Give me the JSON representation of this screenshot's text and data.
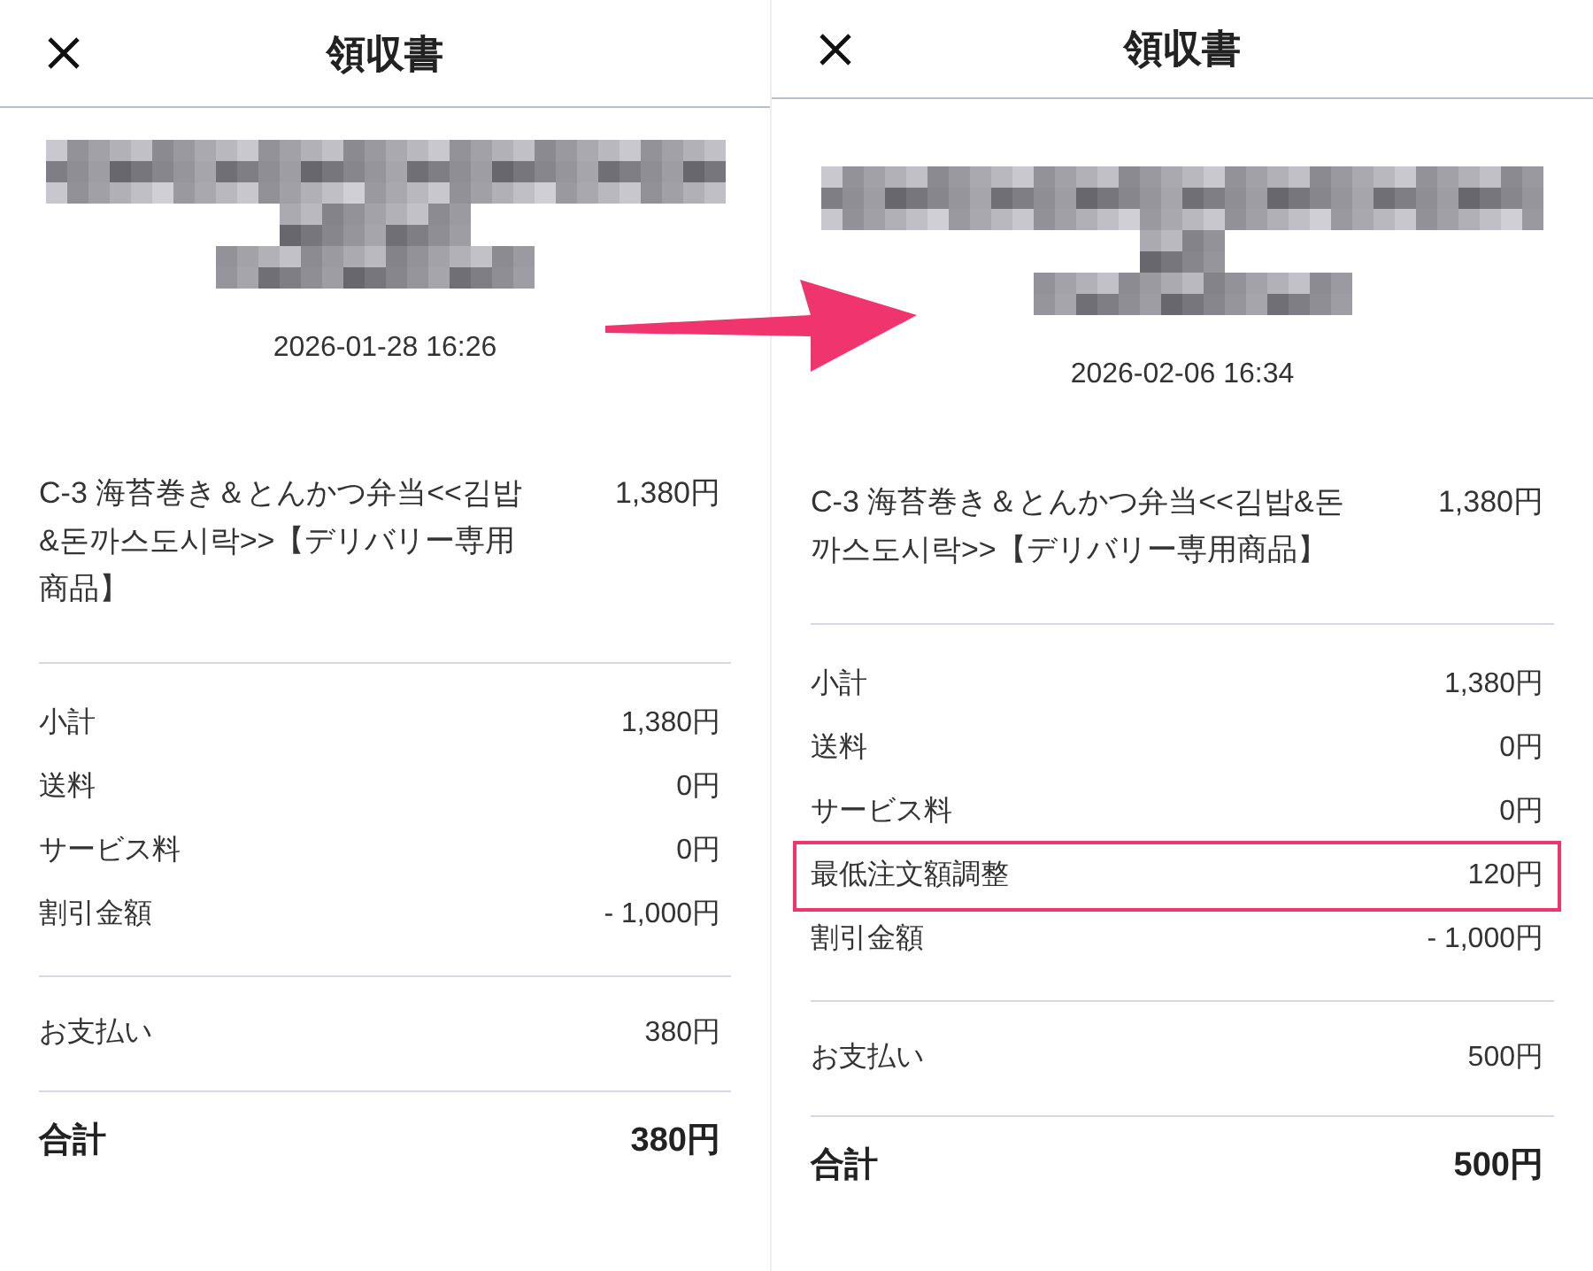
{
  "arrow": {
    "kind": "arrow"
  },
  "receipts": [
    {
      "title": "領収書",
      "date": "2026-01-28 16:26",
      "item": {
        "name": "C-3 海苔巻き＆とんかつ弁当<<김밥&돈까스도시락>>【デリバリー専用商品】",
        "price": "1,380円"
      },
      "fees": [
        {
          "label": "小計",
          "value": "1,380円",
          "highlighted": false
        },
        {
          "label": "送料",
          "value": "0円",
          "highlighted": false
        },
        {
          "label": "サービス料",
          "value": "0円",
          "highlighted": false
        },
        {
          "label": "割引金額",
          "value": "- 1,000円",
          "highlighted": false
        }
      ],
      "payment": {
        "label": "お支払い",
        "value": "380円"
      },
      "total": {
        "label": "合計",
        "value": "380円"
      }
    },
    {
      "title": "領収書",
      "date": "2026-02-06 16:34",
      "item": {
        "name": "C-3 海苔巻き＆とんかつ弁当<<김밥&돈까스도시락>>【デリバリー専用商品】",
        "price": "1,380円"
      },
      "fees": [
        {
          "label": "小計",
          "value": "1,380円",
          "highlighted": false
        },
        {
          "label": "送料",
          "value": "0円",
          "highlighted": false
        },
        {
          "label": "サービス料",
          "value": "0円",
          "highlighted": false
        },
        {
          "label": "最低注文額調整",
          "value": "120円",
          "highlighted": true
        },
        {
          "label": "割引金額",
          "value": "- 1,000円",
          "highlighted": false
        }
      ],
      "payment": {
        "label": "お支払い",
        "value": "500円"
      },
      "total": {
        "label": "合計",
        "value": "500円"
      }
    }
  ]
}
